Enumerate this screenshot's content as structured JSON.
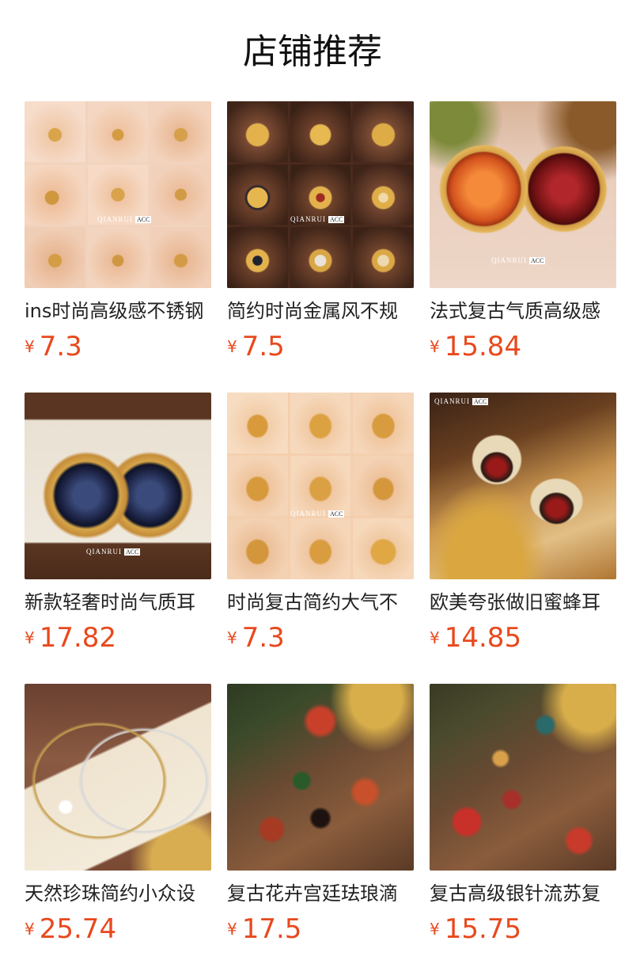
{
  "header": {
    "title": "店铺推荐"
  },
  "brand": {
    "name": "QIANRUI",
    "tag": "ACC"
  },
  "currency_symbol": "¥",
  "colors": {
    "price": "#e8491d",
    "title": "#111111",
    "name": "#222222",
    "background": "#ffffff"
  },
  "products": [
    {
      "name": "ins时尚高级感不锈钢",
      "price": "7.3",
      "image": "gold-pendant-necklaces-grid"
    },
    {
      "name": "简约时尚金属风不规",
      "price": "7.5",
      "image": "gold-rings-grid"
    },
    {
      "name": "法式复古气质高级感",
      "price": "15.84",
      "image": "red-stone-stud-earrings"
    },
    {
      "name": "新款轻奢时尚气质耳",
      "price": "17.82",
      "image": "blue-gem-gold-earrings"
    },
    {
      "name": "时尚复古简约大气不",
      "price": "7.3",
      "image": "gold-hoop-earrings-grid"
    },
    {
      "name": "欧美夸张做旧蜜蜂耳",
      "price": "14.85",
      "image": "vintage-bee-earrings"
    },
    {
      "name": "天然珍珠简约小众设",
      "price": "25.74",
      "image": "pearl-collar-necklace"
    },
    {
      "name": "复古花卉宫廷珐琅滴",
      "price": "17.5",
      "image": "enamel-flower-earrings"
    },
    {
      "name": "复古高级银针流苏复",
      "price": "15.75",
      "image": "vintage-enamel-earrings"
    }
  ]
}
